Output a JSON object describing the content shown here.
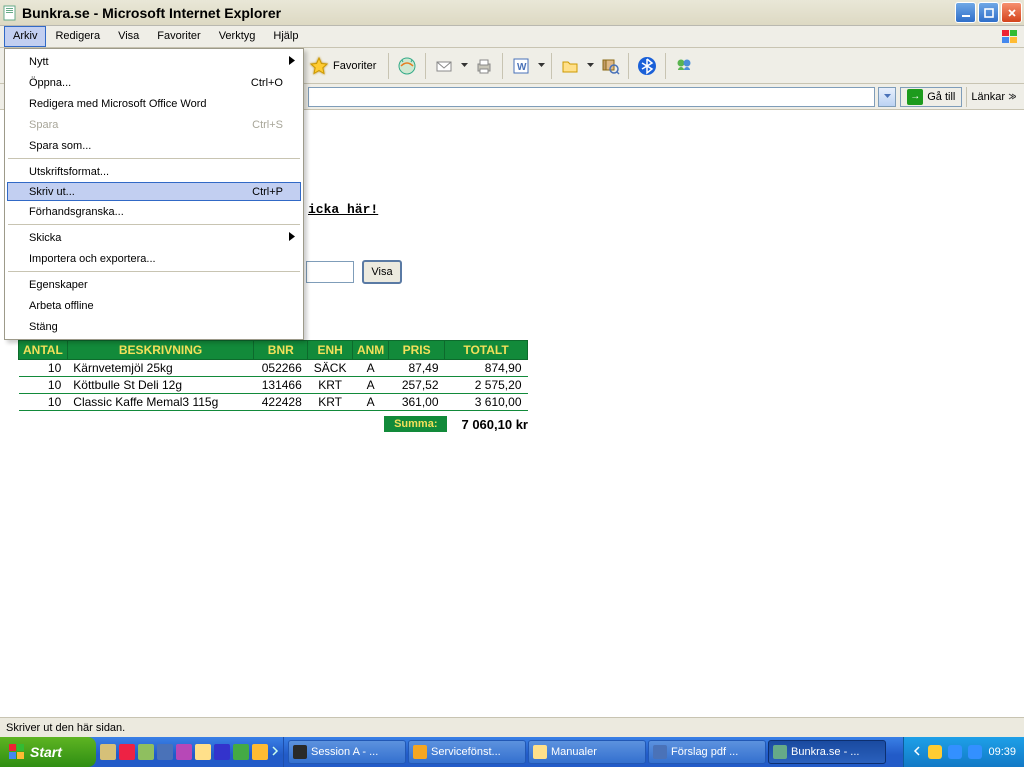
{
  "window": {
    "title": "Bunkra.se - Microsoft Internet Explorer"
  },
  "menubar": {
    "items": [
      "Arkiv",
      "Redigera",
      "Visa",
      "Favoriter",
      "Verktyg",
      "Hjälp"
    ]
  },
  "dropdown": {
    "nytt": "Nytt",
    "oppna": "Öppna...",
    "oppna_short": "Ctrl+O",
    "redigera_word": "Redigera med Microsoft Office Word",
    "spara": "Spara",
    "spara_short": "Ctrl+S",
    "spara_som": "Spara som...",
    "utskriftsformat": "Utskriftsformat...",
    "skriv_ut": "Skriv ut...",
    "skriv_ut_short": "Ctrl+P",
    "forhandsgranska": "Förhandsgranska...",
    "skicka": "Skicka",
    "importera": "Importera och exportera...",
    "egenskaper": "Egenskaper",
    "arbeta_offline": "Arbeta offline",
    "stang": "Stäng"
  },
  "toolbar": {
    "favoriter": "Favoriter"
  },
  "address": {
    "go": "Gå till",
    "links": "Länkar"
  },
  "page": {
    "hint": "icka här!",
    "visa": "Visa"
  },
  "table": {
    "headers": {
      "antal": "ANTAL",
      "beskrivning": "BESKRIVNING",
      "bnr": "BNR",
      "enh": "ENH",
      "anm": "ANM",
      "pris": "PRIS",
      "totalt": "TOTALT"
    },
    "rows": [
      {
        "antal": "10",
        "beskrivning": "Kärnvetemjöl 25kg",
        "bnr": "052266",
        "enh": "SÄCK",
        "anm": "A",
        "pris": "87,49",
        "totalt": "874,90"
      },
      {
        "antal": "10",
        "beskrivning": "Köttbulle St Deli 12g",
        "bnr": "131466",
        "enh": "KRT",
        "anm": "A",
        "pris": "257,52",
        "totalt": "2 575,20"
      },
      {
        "antal": "10",
        "beskrivning": "Classic Kaffe Memal3 115g",
        "bnr": "422428",
        "enh": "KRT",
        "anm": "A",
        "pris": "361,00",
        "totalt": "3 610,00"
      }
    ],
    "sum_label": "Summa:",
    "sum_value": "7 060,10 kr"
  },
  "status": {
    "text": "Skriver ut den här sidan."
  },
  "taskbar": {
    "start": "Start",
    "tasks": [
      {
        "label": "Session A - ..."
      },
      {
        "label": "Servicefönst..."
      },
      {
        "label": "Manualer"
      },
      {
        "label": "Förslag pdf ..."
      },
      {
        "label": "Bunkra.se - ...",
        "active": true
      }
    ],
    "clock": "09:39"
  }
}
